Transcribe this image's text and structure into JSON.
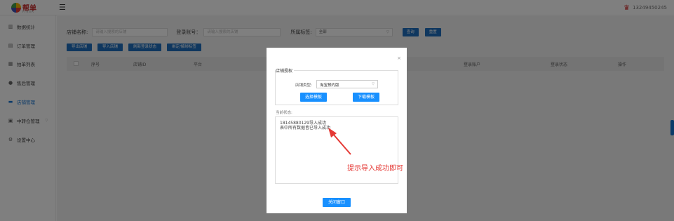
{
  "header": {
    "logo_text": "帮单",
    "logo_subtext": "FIRSA",
    "user_phone": "13249450245",
    "icons": {
      "menu": "hamburger-icon",
      "crown": "crown-icon"
    }
  },
  "sidebar": {
    "items": [
      {
        "label": "数据统计",
        "icon": "bar-chart-icon"
      },
      {
        "label": "订单管理",
        "icon": "list-icon"
      },
      {
        "label": "拍单列表",
        "icon": "table-icon"
      },
      {
        "label": "售后管理",
        "icon": "user-icon"
      },
      {
        "label": "店铺管理",
        "icon": "store-icon",
        "active": true
      },
      {
        "label": "中转仓管理",
        "icon": "warehouse-icon"
      },
      {
        "label": "设置中心",
        "icon": "gear-icon"
      }
    ]
  },
  "filters": {
    "store_name_label": "店铺名称:",
    "store_name_placeholder": "请输入搜索的店铺",
    "login_account_label": "登录账号：",
    "login_account_placeholder": "请输入搜索的店铺",
    "platform_label": "所属标签:",
    "platform_value": "全部",
    "query_button": "查询",
    "reset_button": "重置"
  },
  "actions": {
    "export_store": "导出店铺",
    "import_store": "导入店铺",
    "refresh_login": "刷新登录状态",
    "bind_tag": "绑定/解绑标签"
  },
  "table": {
    "columns": [
      "序号",
      "店铺ID",
      "平台",
      "登录账户",
      "登录状态",
      "操作"
    ]
  },
  "modal": {
    "section_title": "店铺授权",
    "store_type_label": "店铺类型:",
    "store_type_value": "淘宝预约版",
    "choose_template_button": "选择模板",
    "download_template_button": "下载模板",
    "status_label": "当前状态:",
    "status_lines": [
      "18145880129导入成功",
      "表中所有数据皆已导入成功"
    ],
    "close_button": "关闭窗口"
  },
  "annotation": {
    "text": "提示导入成功即可",
    "color": "#e53935"
  }
}
